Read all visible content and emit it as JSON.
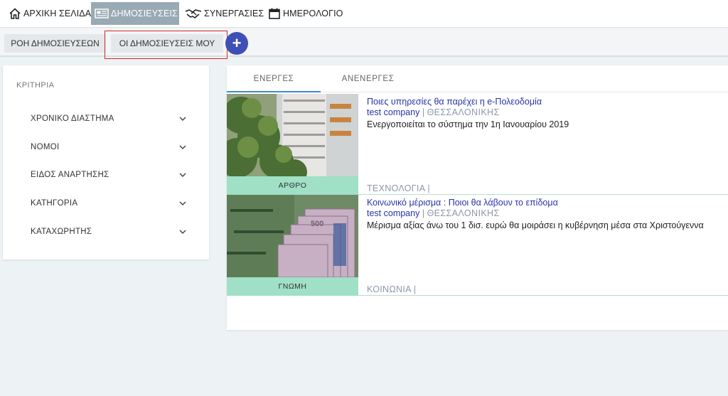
{
  "nav": {
    "home": {
      "label": "ΑΡΧΙΚΗ ΣΕΛΙΔΑ",
      "icon": "home-icon"
    },
    "publications": {
      "label": "ΔΗΜΟΣΙΕΥΣΕΙΣ",
      "icon": "newspaper-icon"
    },
    "collaborations": {
      "label": "ΣΥΝΕΡΓΑΣΙΕΣ",
      "icon": "handshake-icon"
    },
    "calendar": {
      "label": "ΗΜΕΡΟΛΟΓΙΟ",
      "icon": "calendar-icon"
    }
  },
  "subnav": {
    "feed": "ΡΟΗ ΔΗΜΟΣΙΕΥΣΕΩΝ",
    "mine": "ΟΙ ΔΗΜΟΣΙΕΥΣΕΙΣ ΜΟΥ",
    "add": "+"
  },
  "filters": {
    "title": "ΚΡΙΤΗΡΙΑ",
    "items": [
      {
        "label": "ΧΡΟΝΙΚΟ ΔΙΑΣΤΗΜΑ"
      },
      {
        "label": "ΝΟΜΟΙ"
      },
      {
        "label": "ΕΙΔΟΣ ΑΝΑΡΤΗΣΗΣ"
      },
      {
        "label": "ΚΑΤΗΓΟΡΙΑ"
      },
      {
        "label": "ΚΑΤΑΧΩΡΗΤΗΣ"
      }
    ]
  },
  "tabs": {
    "active": "ΕΝΕΡΓΕΣ",
    "inactive": "ΑΝΕΝΕΡΓΕΣ"
  },
  "posts": [
    {
      "type": "ΑΡΘΡΟ",
      "title": "Ποιες υπηρεσίες θα παρέχει η e-Πολεοδομία",
      "company": "test company",
      "separator": "|",
      "city": "ΘΕΣΣΑΛΟΝΙΚΗΣ",
      "description": "Ενεργοποιείται το σύστημα την 1η Ιανουαρίου 2019",
      "category": "ΤΕΧΝΟΛΟΓΙΑ |"
    },
    {
      "type": "ΓΝΩΜΗ",
      "title": "Κοινωνικό μέρισμα : Ποιοι θα λάβουν το επίδομα",
      "company": "test company",
      "separator": "|",
      "city": "ΘΕΣΣΑΛΟΝΙΚΗΣ",
      "description": "Μέρισμα αξίας άνω του 1 δισ. ευρώ θα μοιράσει η κυβέρνηση μέσα στα Χριστούγεννα",
      "category": "ΚΟΙΝΩΝΙΑ |"
    }
  ],
  "colors": {
    "accent": "#3f4fb5",
    "active_nav": "#99aab4",
    "type_badge": "#9fe0c6",
    "link": "#2733a8",
    "highlight": "#d32b2b"
  }
}
